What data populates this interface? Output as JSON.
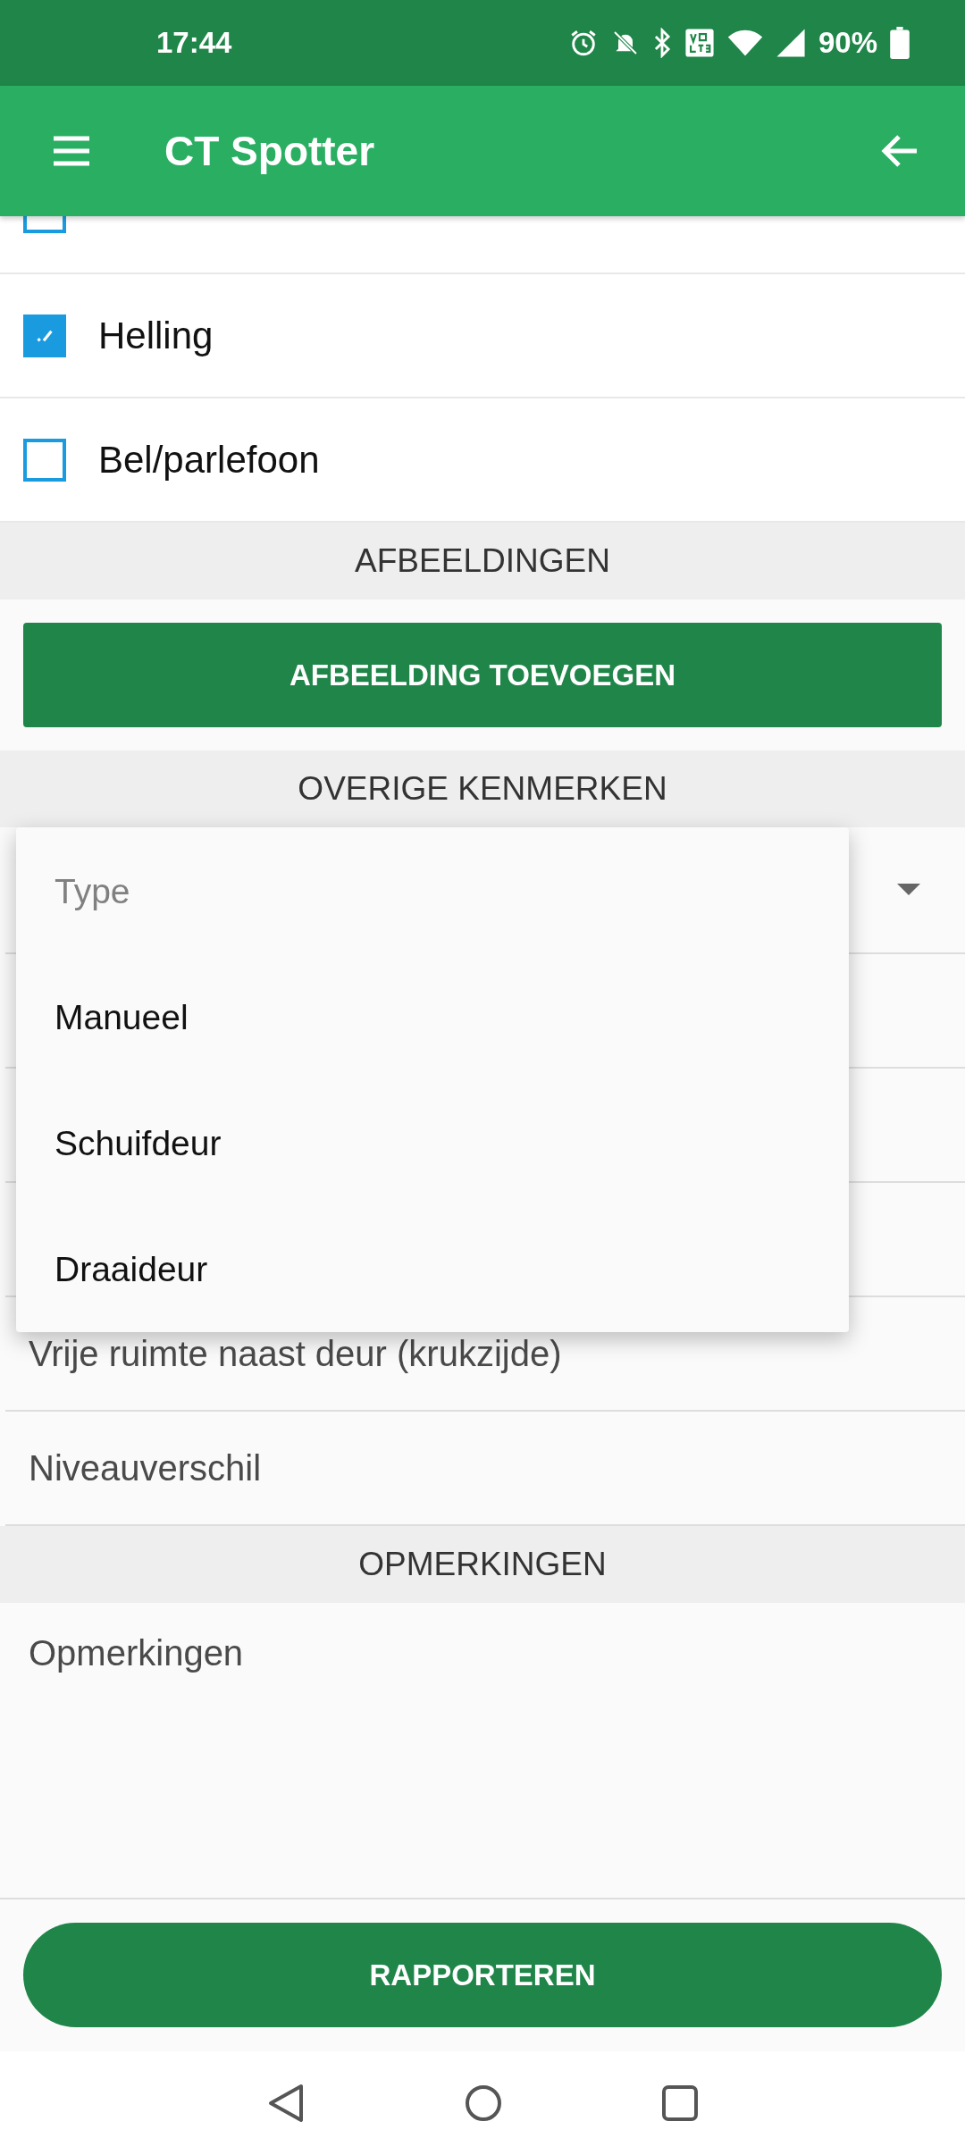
{
  "status_bar": {
    "time": "17:44",
    "battery": "90%"
  },
  "app_bar": {
    "title": "CT Spotter"
  },
  "checklist": [
    {
      "checked": false
    },
    {
      "label": "Helling",
      "checked": true
    },
    {
      "label": "Bel/parlefoon",
      "checked": false
    }
  ],
  "images_section": {
    "header": "AFBEELDINGEN",
    "button": "AFBEELDING TOEVOEGEN"
  },
  "other_section": {
    "header": "OVERIGE KENMERKEN",
    "type_dropdown": {
      "placeholder": "Type",
      "expanded": true,
      "options": [
        {
          "label": "Manueel"
        },
        {
          "label": "Schuifdeur"
        },
        {
          "label": "Draaideur"
        }
      ]
    },
    "fields": [
      {
        "placeholder": "Vrije ruimte naast deur (krukzijde)"
      },
      {
        "placeholder": "Niveauverschil"
      }
    ]
  },
  "remarks_section": {
    "header": "OPMERKINGEN",
    "placeholder": "Opmerkingen"
  },
  "submit_button": "RAPPORTEREN"
}
